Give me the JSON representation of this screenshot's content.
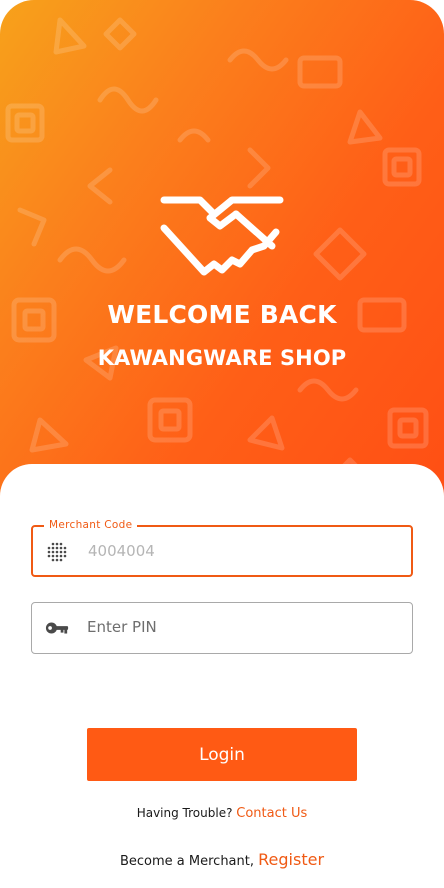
{
  "header": {
    "welcome_title": "WELCOME BACK",
    "shop_name": "KAWANGWARE SHOP",
    "logo_icon": "handshake-icon"
  },
  "form": {
    "merchant_code": {
      "label": "Merchant Code",
      "value": "4004004",
      "icon": "keypad-icon"
    },
    "pin": {
      "placeholder": "Enter PIN",
      "value": "",
      "icon": "key-icon"
    },
    "login_label": "Login"
  },
  "footer": {
    "trouble_text": "Having Trouble?",
    "contact_link": "Contact Us",
    "merchant_text": "Become a Merchant,",
    "register_link": "Register"
  },
  "colors": {
    "accent": "#ff5a14",
    "accent_text": "#f05a14",
    "gradient_start": "#f7a21b",
    "gradient_end": "#ff4e14",
    "field_border": "#a9a9a9"
  }
}
